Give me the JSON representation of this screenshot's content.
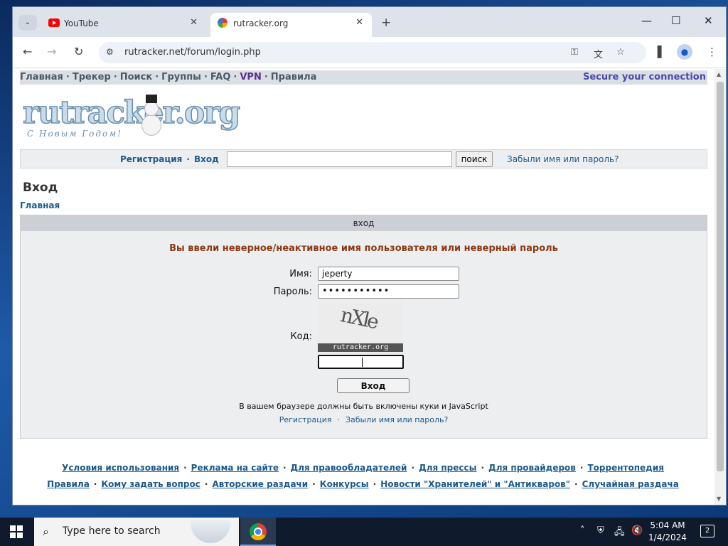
{
  "browser": {
    "tabs": [
      {
        "title": "YouTube"
      },
      {
        "title": "rutracker.org"
      }
    ],
    "url": "rutracker.net/forum/login.php"
  },
  "site": {
    "nav": {
      "items": [
        "Главная",
        "Трекер",
        "Поиск",
        "Группы",
        "FAQ",
        "VPN",
        "Правила"
      ],
      "secure": "Secure your connection"
    },
    "logo": {
      "text": "rutracker.org",
      "subtitle": "С Новым Годом!"
    },
    "loginbar": {
      "register": "Регистрация",
      "login": "Вход",
      "search_button": "поиск",
      "forgot": "Забыли имя или пароль?"
    },
    "page_title": "Вход",
    "breadcrumb": "Главная",
    "login_box": {
      "header": "вход",
      "error": "Вы ввели неверное/неактивное имя пользователя или неверный пароль",
      "username_label": "Имя:",
      "username_value": "jeperty",
      "password_label": "Пароль:",
      "password_masked": "•••••••••••",
      "code_label": "Код:",
      "captcha_text": "nXle",
      "captcha_caption": "rutracker.org",
      "submit": "Вход",
      "cookies_note": "В вашем браузере должны быть включены куки и JavaScript",
      "register_link": "Регистрация",
      "forgot_link": "Забыли имя или пароль?"
    },
    "footer": {
      "row1": [
        "Условия использования",
        "Реклама на сайте",
        "Для правообладателей",
        "Для прессы",
        "Для провайдеров",
        "Торрентопедия"
      ],
      "row2": [
        "Правила",
        "Кому задать вопрос",
        "Авторские раздачи",
        "Конкурсы",
        "Новости \"Хранителей\" и \"Антикваров\"",
        "Случайная раздача"
      ]
    }
  },
  "taskbar": {
    "search_placeholder": "Type here to search",
    "time": "5:04 AM",
    "date": "1/4/2024",
    "notifications": "2"
  },
  "icons": {
    "tab_search": "chevron-down-icon",
    "new_tab": "plus-icon",
    "key": "key-icon",
    "translate": "translate-icon",
    "bookmark": "star-icon",
    "sidebar": "side-panel-icon",
    "menu": "kebab-menu-icon"
  }
}
